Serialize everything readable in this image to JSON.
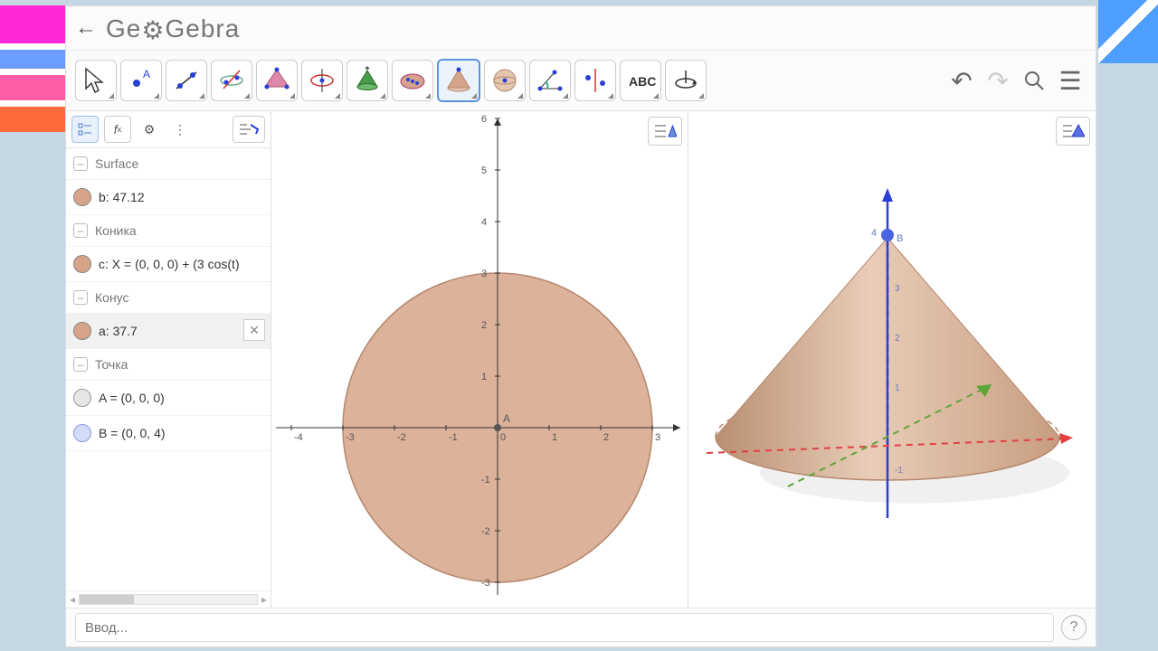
{
  "app_name": "GeoGebra",
  "input": {
    "placeholder": "Ввод...",
    "value": ""
  },
  "colors": {
    "fill": "#d6a488",
    "fillStroke": "#b5876c",
    "pointA": "#9aa0a6",
    "pointB": "#b3c0f2",
    "axisBlue": "#2a3fd6",
    "axisRed": "#e04040",
    "axisGreen": "#5ca63a"
  },
  "algebra": {
    "categories": [
      {
        "label": "Surface",
        "items": [
          {
            "name": "b",
            "text": "b: 47.12",
            "swatch": "#d6a488"
          }
        ]
      },
      {
        "label": "Коника",
        "items": [
          {
            "name": "c",
            "text": "c: X = (0, 0, 0) + (3 cos(t)",
            "swatch": "#d6a488"
          }
        ]
      },
      {
        "label": "Конус",
        "items": [
          {
            "name": "a",
            "text": "a: 37.7",
            "swatch": "#d6a488",
            "selected": true,
            "closable": true
          }
        ]
      },
      {
        "label": "Точка",
        "items": [
          {
            "name": "A",
            "text": "A = (0, 0, 0)",
            "swatch": "#cfcfcf"
          },
          {
            "name": "B",
            "text": "B = (0, 0, 4)",
            "swatch": "#c5cdf5"
          }
        ]
      }
    ]
  },
  "view2d": {
    "xTicks": [
      -4,
      -3,
      -2,
      -1,
      0,
      1,
      2,
      3
    ],
    "yTicks": [
      -3,
      -2,
      -1,
      1,
      2,
      3,
      4,
      5,
      6
    ],
    "pointLabel": "A",
    "circleRadius": 3
  },
  "view3d": {
    "zTop": 4,
    "pointTopLabel": "B"
  },
  "toolbar_alt": {
    "move": "Move",
    "point": "Point",
    "line": "Line",
    "intersect": "Intersect two surfaces",
    "pyramid": "Pyramid",
    "circle3d": "Circle 3D",
    "extrude": "Extrude",
    "sphere": "Sphere",
    "cone": "Cone",
    "circlecenter": "Sphere center",
    "angle3d": "Angle",
    "reflect": "Reflect",
    "text": "Text",
    "rotateview": "Rotate view"
  }
}
